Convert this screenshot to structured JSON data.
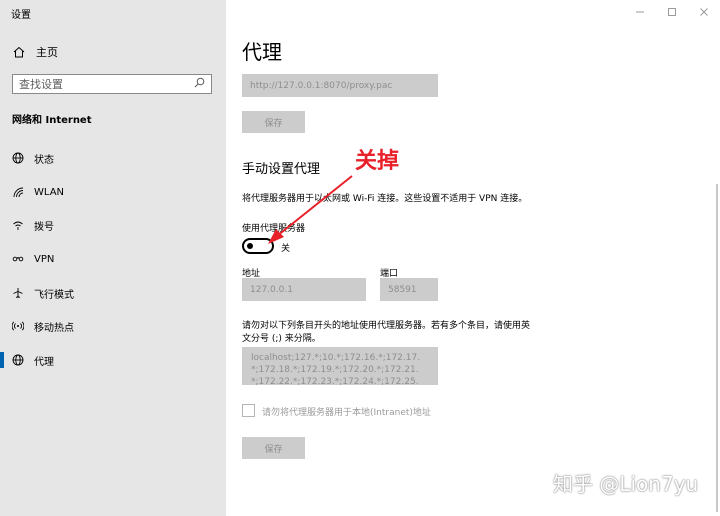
{
  "window": {
    "title": "设置"
  },
  "sidebar": {
    "home_label": "主页",
    "search_placeholder": "查找设置",
    "section_title": "网络和 Internet",
    "items": [
      {
        "label": "状态",
        "icon": "globe-icon"
      },
      {
        "label": "WLAN",
        "icon": "wifi-icon"
      },
      {
        "label": "拨号",
        "icon": "dial-icon"
      },
      {
        "label": "VPN",
        "icon": "vpn-icon"
      },
      {
        "label": "飞行模式",
        "icon": "airplane-icon"
      },
      {
        "label": "移动热点",
        "icon": "hotspot-icon"
      },
      {
        "label": "代理",
        "icon": "globe-icon",
        "active": true
      }
    ]
  },
  "main": {
    "title": "代理",
    "script_address": "http://127.0.0.1:8070/proxy.pac",
    "save_label": "保存",
    "manual_heading": "手动设置代理",
    "manual_desc": "将代理服务器用于以太网或 Wi-Fi 连接。这些设置不适用于 VPN 连接。",
    "use_proxy_label": "使用代理服务器",
    "toggle_state": "关",
    "address_label": "地址",
    "address_value": "127.0.0.1",
    "port_label": "端口",
    "port_value": "58591",
    "exceptions_desc_line1": "请勿对以下列条目开头的地址使用代理服务器。若有多个条目，请使用英",
    "exceptions_desc_line2": "文分号 (;) 来分隔。",
    "exceptions_line1": "localhost;127.*;10.*;172.16.*;172.17.",
    "exceptions_line2": "*;172.18.*;172.19.*;172.20.*;172.21.",
    "exceptions_line3": "*;172.22.*;172.23.*;172.24.*;172.25.",
    "local_bypass_label": "请勿将代理服务器用于本地(Intranet)地址",
    "save2_label": "保存"
  },
  "annotation": {
    "text": "关掉",
    "color": "#e8202a"
  },
  "watermark": {
    "text": "知乎 @Lion7yu"
  },
  "colors": {
    "sidebar_bg": "#e6e6e6",
    "accent": "#0063b1",
    "disabled_bg": "#cccccc"
  }
}
